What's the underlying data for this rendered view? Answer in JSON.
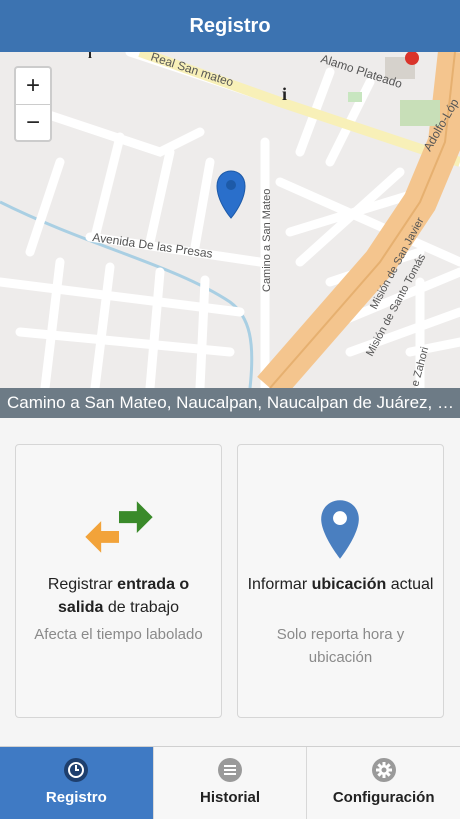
{
  "header": {
    "title": "Registro"
  },
  "map": {
    "zoom_in": "+",
    "zoom_out": "−",
    "street_labels": {
      "real_san_mateo": "Real San mateo",
      "alamo_plateado": "Alamo Plateado",
      "adolfo_lopez": "Adolfo-Lóp",
      "avenida_presas": "Avenida De las Presas",
      "camino_san_mateo": "Camino a San Mateo",
      "mision_san_javier": "Misión de San Javier",
      "mision_santo_tomas": "Misión de Santo Tomás",
      "zahori": "e Zahori"
    },
    "address": "Camino a San Mateo, Naucalpan, Naucalpan de Juárez, México"
  },
  "cards": {
    "entry": {
      "main_prefix": "Registrar ",
      "main_bold": "entrada o salida",
      "main_suffix": " de trabajo",
      "sub": "Afecta el tiempo labolado"
    },
    "location": {
      "main_prefix": "Informar ",
      "main_bold": "ubicación",
      "main_suffix": " actual",
      "sub": "Solo reporta hora y ubicación"
    }
  },
  "tabs": {
    "registro": "Registro",
    "historial": "Historial",
    "configuracion": "Configuración"
  },
  "colors": {
    "header": "#3c73b1",
    "active_tab": "#3f7ac4",
    "pin": "#4a7fc0",
    "arrow_green": "#3a8a2a",
    "arrow_orange": "#f2a33a",
    "highway": "#f4c58e"
  }
}
